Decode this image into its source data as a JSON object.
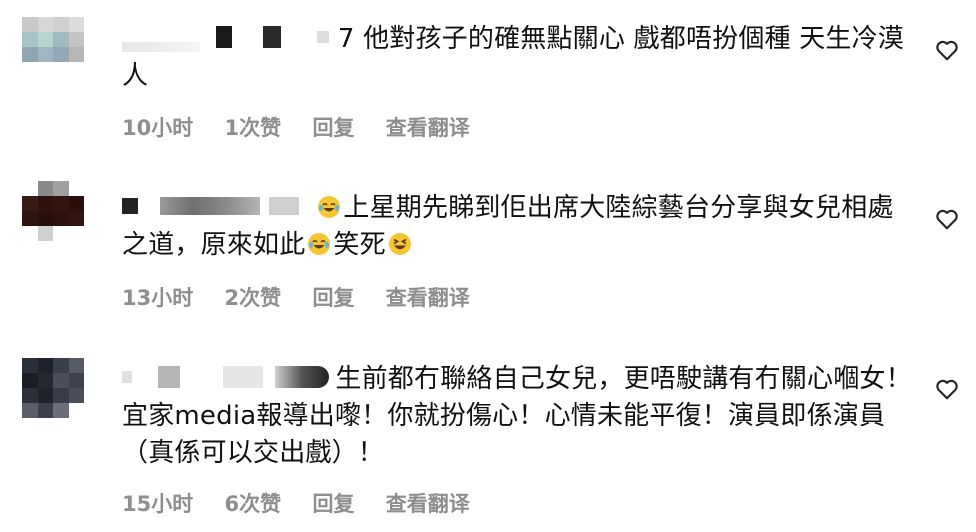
{
  "comments": [
    {
      "username": "",
      "text_before": "",
      "text": "7 他對孩子的確無點關心 戲都唔扮個種 天生冷漠人",
      "time": "10小时",
      "likes": "1次赞",
      "reply": "回复",
      "translate": "查看翻译"
    },
    {
      "username": "",
      "text": "上星期先睇到佢出席大陸綜藝台分享與女兒相處之道，原來如此",
      "text_after": "笑死",
      "time": "13小时",
      "likes": "2次赞",
      "reply": "回复",
      "translate": "查看翻译"
    },
    {
      "username": "",
      "text": "生前都冇聯絡自己女兒，更唔駛講有冇關心嗰女！宜家media報導出嚟！你就扮傷心！心情未能平復！演員即係演員（真係可以交出戲）！",
      "time": "15小时",
      "likes": "6次赞",
      "reply": "回复",
      "translate": "查看翻译"
    }
  ],
  "icons": {
    "heart": "heart-outline-icon",
    "emoji_laugh": "tears-of-joy-icon",
    "emoji_grin": "grinning-squint-icon"
  },
  "colors": {
    "meta_text": "#8e8e8e",
    "body_text": "#111111",
    "emoji": "#f7c531"
  }
}
